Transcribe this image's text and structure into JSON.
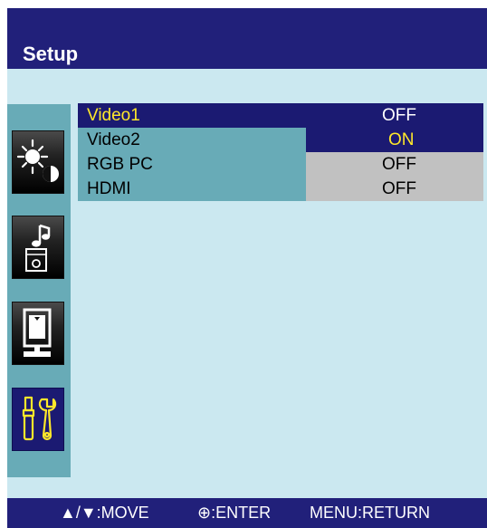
{
  "header": {
    "title": "Setup"
  },
  "sidebar": {
    "items": [
      {
        "icon": "brightness-contrast-icon",
        "active": false
      },
      {
        "icon": "audio-icon",
        "active": false
      },
      {
        "icon": "pip-screen-icon",
        "active": false
      },
      {
        "icon": "setup-tools-icon",
        "active": true
      }
    ]
  },
  "menu": {
    "rows": [
      {
        "label": "Video1",
        "value": "OFF"
      },
      {
        "label": "Video2",
        "value": "ON"
      },
      {
        "label": "RGB PC",
        "value": "OFF"
      },
      {
        "label": "HDMI",
        "value": "OFF"
      }
    ]
  },
  "footer": {
    "move": "▲/▼:MOVE",
    "enter": "⊕:ENTER",
    "return": "MENU:RETURN"
  },
  "colors": {
    "header_bg": "#21207a",
    "panel_bg": "#cbe8f0",
    "sidebar_bg": "#68abb7",
    "highlight": "#1b1a72",
    "highlight_text": "#ffe82a",
    "value_bg": "#c1c1c1"
  }
}
